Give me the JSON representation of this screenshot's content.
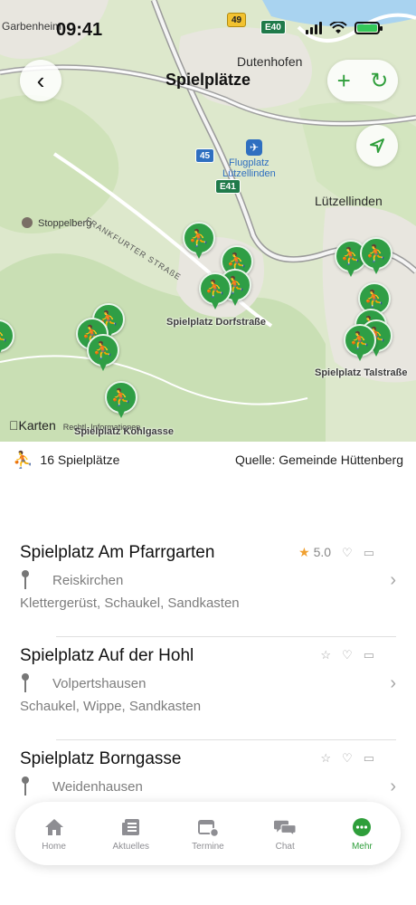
{
  "status_bar": {
    "time": "09:41"
  },
  "header": {
    "title": "Spielplätze"
  },
  "map": {
    "places": {
      "garbenheim": "Garbenheim",
      "dutenhofen": "Dutenhofen",
      "luetzellinden": "Lützellinden",
      "stoppelberg": "Stoppelberg",
      "airport": "Flugplatz\nLützellinden",
      "frankfurter": "FRANKFURTER STRAßE"
    },
    "shields": {
      "b49": "49",
      "e40": "E40",
      "a45": "45",
      "e41": "E41"
    },
    "marker_labels": {
      "dorfstrasse": "Spielplatz Dorfstraße",
      "talstrasse": "Spielplatz Talstraße",
      "kohlgasse": "Spielplatz Kohlgasse"
    },
    "attribution": {
      "brand": "Karten",
      "legal": "Rechtl. Informationen"
    },
    "marker_glyph": "⛹"
  },
  "summary": {
    "count": "16 Spielplätze",
    "source": "Quelle: Gemeinde Hüttenberg"
  },
  "playgrounds": [
    {
      "name": "Spielplatz Am Pfarrgarten",
      "location": "Reiskirchen",
      "equipment": "Klettergerüst, Schaukel, Sandkasten",
      "rating": "5.0"
    },
    {
      "name": "Spielplatz Auf der Hohl",
      "location": "Volpertshausen",
      "equipment": "Schaukel, Wippe, Sandkasten",
      "rating": ""
    },
    {
      "name": "Spielplatz Borngasse",
      "location": "Weidenhausen",
      "equipment": "",
      "rating": ""
    }
  ],
  "tabs": [
    {
      "label": "Home",
      "icon": "home-icon"
    },
    {
      "label": "Aktuelles",
      "icon": "news-icon"
    },
    {
      "label": "Termine",
      "icon": "calendar-icon"
    },
    {
      "label": "Chat",
      "icon": "chat-icon"
    },
    {
      "label": "Mehr",
      "icon": "more-icon"
    }
  ],
  "colors": {
    "accent": "#2e9e3a",
    "marker": "#2f9e45",
    "star": "#f0a030"
  }
}
